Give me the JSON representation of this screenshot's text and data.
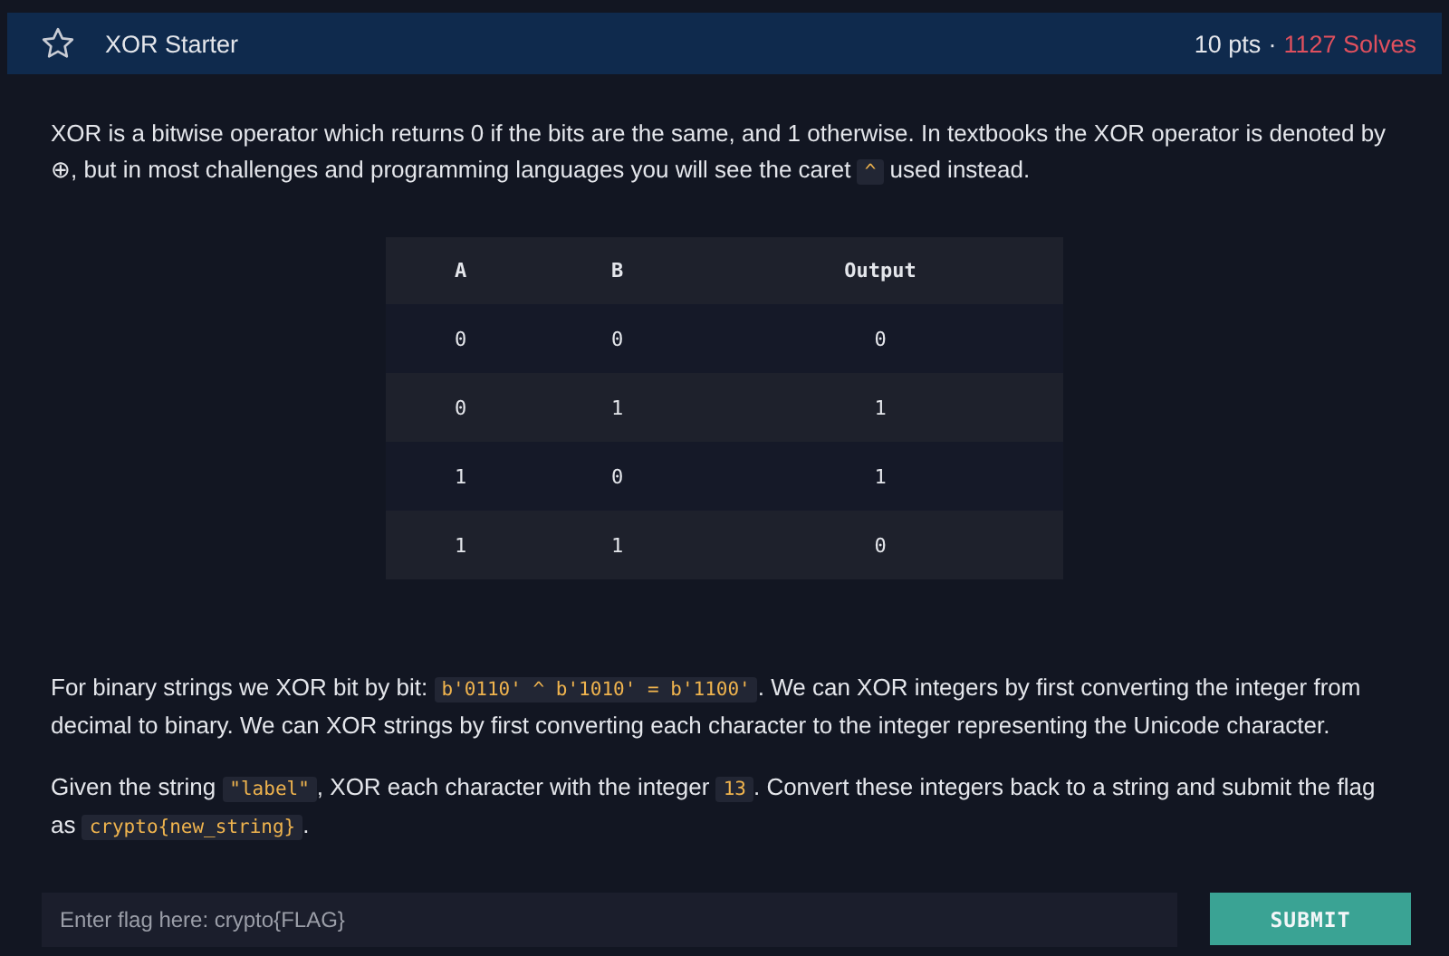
{
  "header": {
    "title": "XOR Starter",
    "points": "10 pts",
    "separator": "·",
    "solves": "1127 Solves"
  },
  "intro": [
    {
      "kind": "text",
      "text": "XOR is a bitwise operator which returns 0 if the bits are the same, and 1 otherwise. In textbooks the XOR operator is denoted by ⊕, but in most challenges and programming languages you will see the caret "
    },
    {
      "kind": "code",
      "text": "^"
    },
    {
      "kind": "text",
      "text": " used instead."
    }
  ],
  "table": {
    "columns": [
      "A",
      "B",
      "Output"
    ],
    "rows": [
      [
        "0",
        "0",
        "0"
      ],
      [
        "0",
        "1",
        "1"
      ],
      [
        "1",
        "0",
        "1"
      ],
      [
        "1",
        "1",
        "0"
      ]
    ]
  },
  "paragraphs": [
    [
      {
        "kind": "text",
        "text": "For binary strings we XOR bit by bit: "
      },
      {
        "kind": "code",
        "text": "b'0110' ^ b'1010' = b'1100'"
      },
      {
        "kind": "text",
        "text": ". We can XOR integers by first converting the integer from decimal to binary. We can XOR strings by first converting each character to the integer representing the Unicode character."
      }
    ],
    [
      {
        "kind": "text",
        "text": "Given the string "
      },
      {
        "kind": "code",
        "text": "\"label\""
      },
      {
        "kind": "text",
        "text": ", XOR each character with the integer "
      },
      {
        "kind": "code",
        "text": "13"
      },
      {
        "kind": "text",
        "text": ". Convert these integers back to a string and submit the flag as "
      },
      {
        "kind": "code",
        "text": "crypto{new_string}"
      },
      {
        "kind": "text",
        "text": "."
      }
    ]
  ],
  "flag_field": {
    "placeholder": "Enter flag here: crypto{FLAG}"
  },
  "submit_button": "SUBMIT"
}
